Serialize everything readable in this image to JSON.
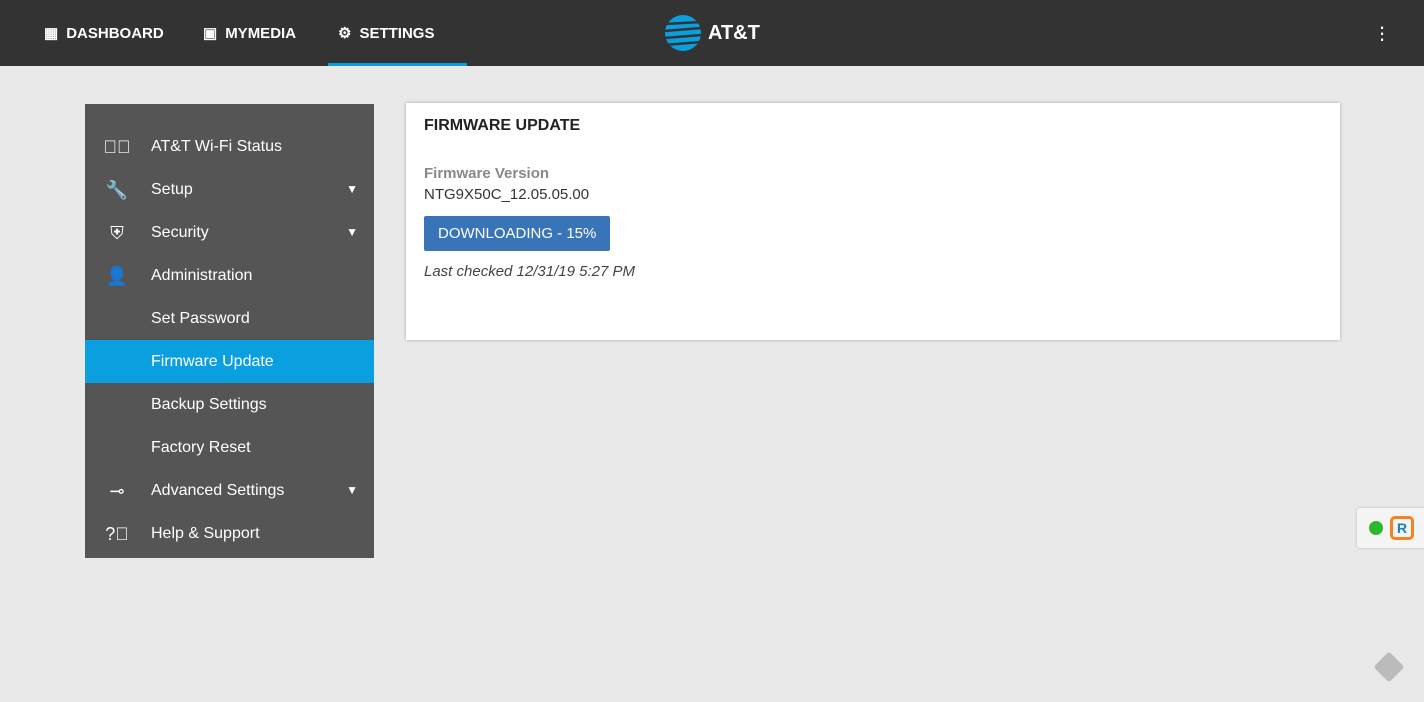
{
  "nav": {
    "dashboard": "DASHBOARD",
    "mymedia": "MYMEDIA",
    "settings": "SETTINGS"
  },
  "logo": "AT&T",
  "sidebar": {
    "items": [
      {
        "label": "AT&T Wi-Fi Status",
        "icon": "check-circle-icon"
      },
      {
        "label": "Setup",
        "icon": "wrench-icon"
      },
      {
        "label": "Security",
        "icon": "shield-icon"
      },
      {
        "label": "Administration",
        "icon": "person-icon"
      },
      {
        "label": "Set Password"
      },
      {
        "label": "Firmware Update"
      },
      {
        "label": "Backup Settings"
      },
      {
        "label": "Factory Reset"
      },
      {
        "label": "Advanced Settings",
        "icon": "toggle-icon"
      },
      {
        "label": "Help & Support",
        "icon": "help-circle-icon"
      }
    ]
  },
  "card": {
    "title": "FIRMWARE UPDATE",
    "version_label": "Firmware Version",
    "version": "NTG9X50C_12.05.05.00",
    "button": "DOWNLOADING - 15%",
    "last_checked": "Last checked 12/31/19 5:27 PM"
  },
  "colors": {
    "accent": "#0aa0e0",
    "button": "#3a74b8"
  }
}
